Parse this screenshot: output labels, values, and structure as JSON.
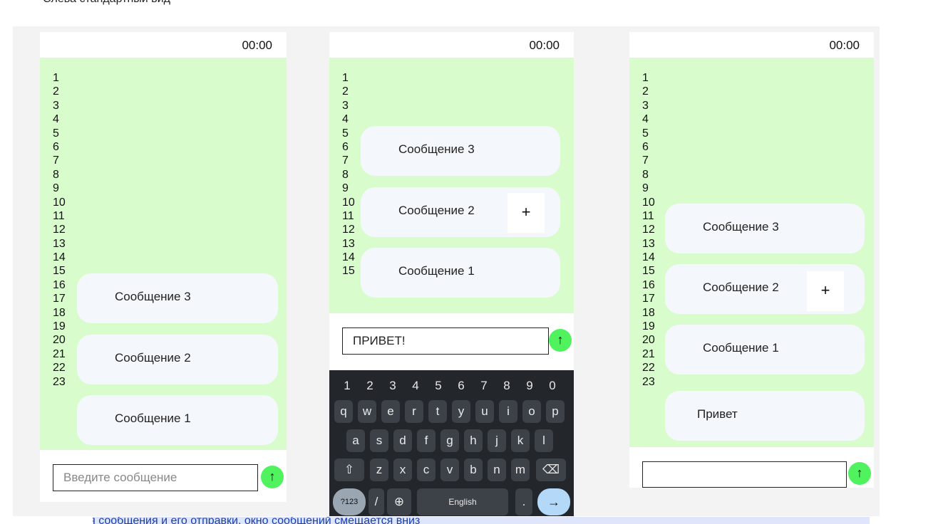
{
  "page": {
    "top_caption": "Слева стандартный вид",
    "bottom_caption": "После написания сообщения и его отправки, окно сообщений смещается вниз"
  },
  "panels": [
    {
      "time": "00:00",
      "line_numbers": [
        "1",
        "2",
        "3",
        "4",
        "5",
        "6",
        "7",
        "8",
        "9",
        "10",
        "11",
        "12",
        "13",
        "14",
        "15",
        "16",
        "17",
        "18",
        "19",
        "20",
        "21",
        "22",
        "23"
      ],
      "messages": [
        {
          "text": "Сообщение 3",
          "plus": ""
        },
        {
          "text": "Сообщение 2",
          "plus": ""
        },
        {
          "text": "Сообщение 1",
          "plus": ""
        }
      ],
      "input": {
        "value": "",
        "placeholder": "Введите сообщение"
      },
      "send_icon": "arrow-up-icon",
      "send_glyph": "↑"
    },
    {
      "time": "00:00",
      "line_numbers": [
        "1",
        "2",
        "3",
        "4",
        "5",
        "6",
        "7",
        "8",
        "9",
        "10",
        "11",
        "12",
        "13",
        "14",
        "15"
      ],
      "messages": [
        {
          "text": "Сообщение 3",
          "plus": ""
        },
        {
          "text": "Сообщение 2",
          "plus": "+"
        },
        {
          "text": "Сообщение 1",
          "plus": ""
        }
      ],
      "input": {
        "value": "ПРИВЕТ!",
        "placeholder": ""
      },
      "send_icon": "arrow-up-icon",
      "send_glyph": "↑",
      "keyboard": {
        "row1": [
          "1",
          "2",
          "3",
          "4",
          "5",
          "6",
          "7",
          "8",
          "9",
          "0"
        ],
        "row2": [
          "q",
          "w",
          "e",
          "r",
          "t",
          "y",
          "u",
          "i",
          "o",
          "p"
        ],
        "row3": [
          "a",
          "s",
          "d",
          "f",
          "g",
          "h",
          "j",
          "k",
          "l"
        ],
        "row4": [
          "z",
          "x",
          "c",
          "v",
          "b",
          "n",
          "m"
        ],
        "shift_icon": "shift-icon",
        "shift_glyph": "⇧",
        "backspace_icon": "backspace-icon",
        "backspace_glyph": "⌫",
        "symbols_label": "?123",
        "slash_label": "/",
        "globe_icon": "globe-icon",
        "globe_glyph": "⊕",
        "space_label": "English",
        "period_label": ".",
        "enter_icon": "arrow-right-icon",
        "enter_glyph": "→"
      }
    },
    {
      "time": "00:00",
      "line_numbers": [
        "1",
        "2",
        "3",
        "4",
        "5",
        "6",
        "7",
        "8",
        "9",
        "10",
        "11",
        "12",
        "13",
        "14",
        "15",
        "16",
        "17",
        "18",
        "19",
        "20",
        "21",
        "22",
        "23"
      ],
      "messages": [
        {
          "text": "Сообщение 3",
          "plus": ""
        },
        {
          "text": "Сообщение 2",
          "plus": "+"
        },
        {
          "text": "Сообщение 1",
          "plus": ""
        },
        {
          "text": "Привет",
          "plus": ""
        }
      ],
      "input": {
        "value": "",
        "placeholder": ""
      },
      "send_icon": "arrow-up-icon",
      "send_glyph": "↑"
    }
  ],
  "colors": {
    "chat_background": "#d8fccb",
    "bubble": "#f4f7fb",
    "send_button": "#50f25e",
    "keyboard": "#23272c"
  }
}
